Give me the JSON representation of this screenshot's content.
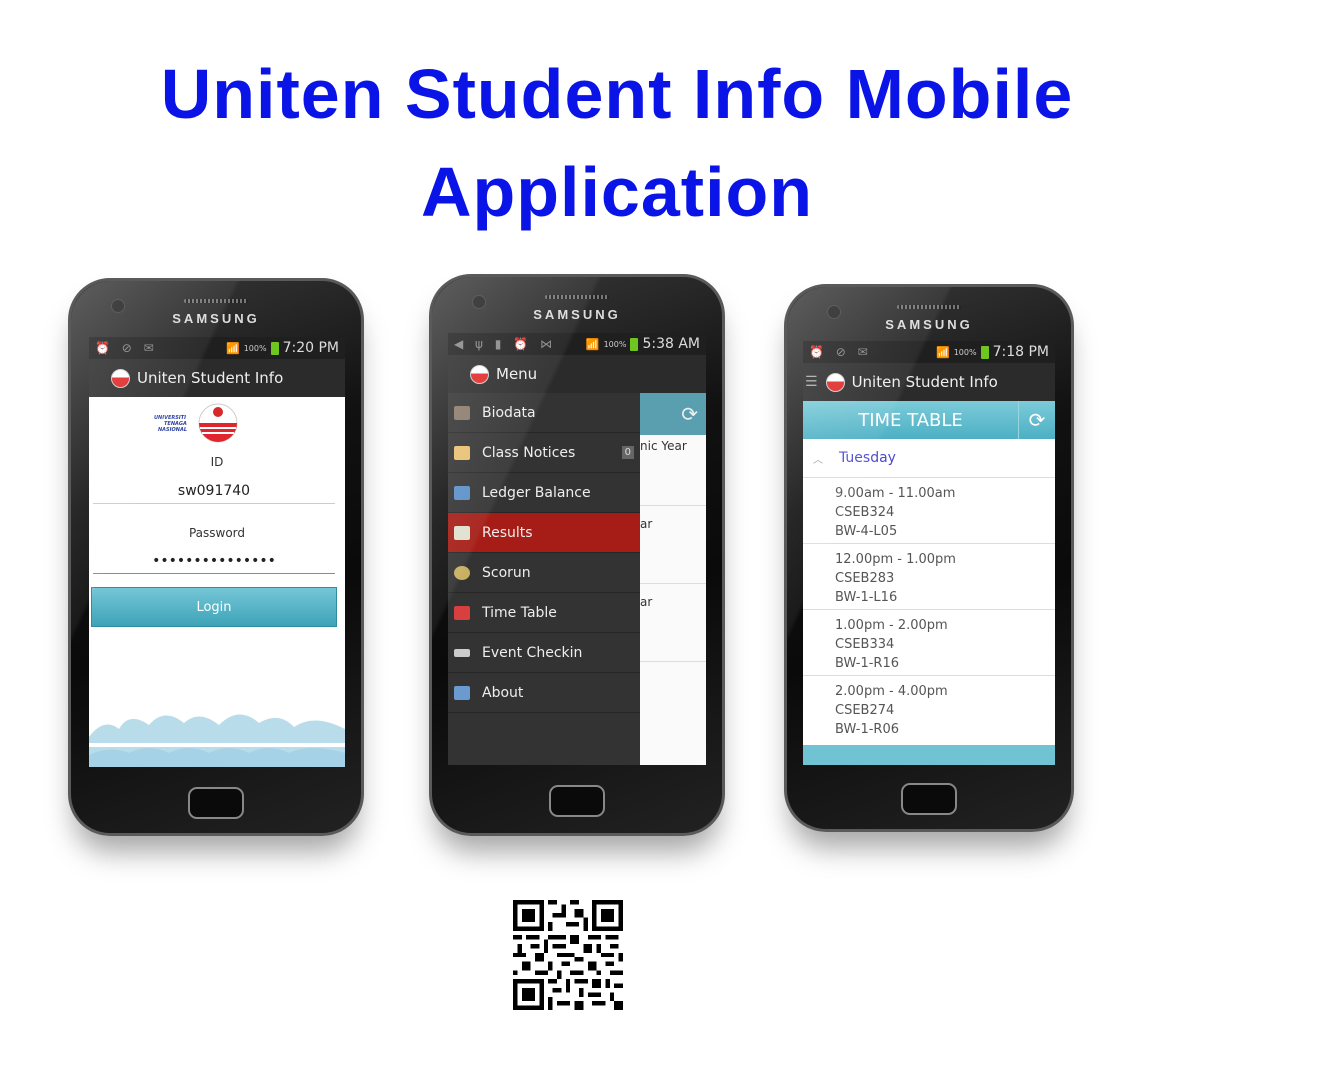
{
  "page_title": {
    "line1": "Uniten Student Info Mobile",
    "line2": "Application"
  },
  "phone_brand": "SAMSUNG",
  "phone1": {
    "time": "7:20 PM",
    "battery": "100%",
    "app_title": "Uniten Student Info",
    "id_label": "ID",
    "id_value": "sw091740",
    "password_label": "Password",
    "password_value": "•••••••••••••••",
    "login_label": "Login"
  },
  "phone2": {
    "time": "5:38 AM",
    "battery": "100%",
    "menu_title": "Menu",
    "behind_text": [
      "nic Year",
      "ar",
      "ar"
    ],
    "menu_items": [
      {
        "label": "Biodata",
        "color": "#8a7a6a"
      },
      {
        "label": "Class Notices",
        "color": "#e8c070",
        "badge": "0"
      },
      {
        "label": "Ledger Balance",
        "color": "#5a8fc8"
      },
      {
        "label": "Results",
        "color": "#e0e0d0",
        "active": true
      },
      {
        "label": "Scorun",
        "color": "#c8b060"
      },
      {
        "label": "Time Table",
        "color": "#d84040"
      },
      {
        "label": "Event Checkin",
        "color": "#cccccc"
      },
      {
        "label": "About",
        "color": "#6a9ad0"
      }
    ]
  },
  "phone3": {
    "time": "7:18 PM",
    "battery": "100%",
    "app_title": "Uniten Student Info",
    "header": "TIME TABLE",
    "day": "Tuesday",
    "slots": [
      {
        "time": "9.00am - 11.00am",
        "code": "CSEB324",
        "room": "BW-4-L05"
      },
      {
        "time": "12.00pm - 1.00pm",
        "code": "CSEB283",
        "room": "BW-1-L16"
      },
      {
        "time": "1.00pm - 2.00pm",
        "code": "CSEB334",
        "room": "BW-1-R16"
      },
      {
        "time": "2.00pm - 4.00pm",
        "code": "CSEB274",
        "room": "BW-1-R06"
      }
    ]
  },
  "colors": {
    "title_blue": "#0a14e6",
    "accent_teal": "#4cb0c4",
    "results_red": "#a51d16"
  }
}
